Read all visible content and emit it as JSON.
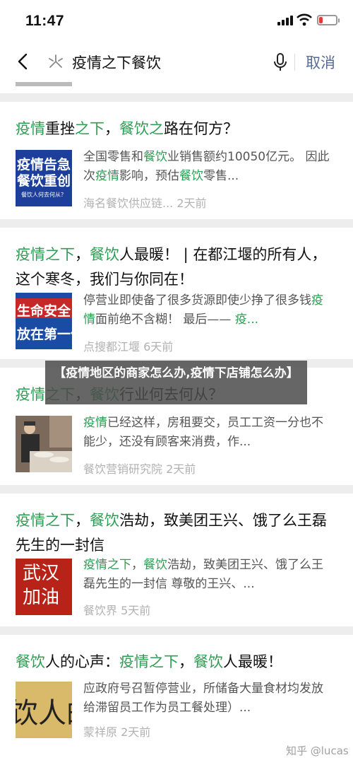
{
  "status": {
    "time": "11:47",
    "battery_level": 0.2
  },
  "search": {
    "query": "疫情之下餐饮",
    "cancel_label": "取消"
  },
  "results": [
    {
      "title": [
        [
          "疫情",
          true
        ],
        [
          "重挫",
          false
        ],
        [
          "之下",
          true
        ],
        [
          "，",
          false
        ],
        [
          "餐饮之",
          true
        ],
        [
          "路在何方？",
          false
        ]
      ],
      "snippet": [
        [
          "全国零售和",
          false
        ],
        [
          "餐饮",
          true
        ],
        [
          "业销售额约10050亿元。 因此次",
          false
        ],
        [
          "疫情",
          true
        ],
        [
          "影响，预估",
          false
        ],
        [
          "餐饮",
          true
        ],
        [
          "零售...",
          false
        ]
      ],
      "meta": "海名餐饮供应链...  2天前",
      "thumb_lines": [
        "疫情告急",
        "餐饮重创",
        "餐饮人何去何从？"
      ]
    },
    {
      "title": [
        [
          "疫情之下",
          true
        ],
        [
          "，",
          false
        ],
        [
          "餐饮",
          true
        ],
        [
          "人最暖！ | 在都江堰的所有人，这个寒冬，我们与你同在！",
          false
        ]
      ],
      "snippet": [
        [
          "停营业即使备了很多货源即使少挣了很多钱",
          false
        ],
        [
          "疫情",
          true
        ],
        [
          "面前绝不含糊！ 最后—— ",
          false
        ],
        [
          "疫...",
          true
        ]
      ],
      "meta": "点搜都江堰  6天前",
      "thumb_lines": [
        "生命安全",
        "放在第一位"
      ]
    },
    {
      "title": [
        [
          "疫情之下",
          true
        ],
        [
          "，",
          false
        ],
        [
          "餐饮",
          true
        ],
        [
          "行业何去何从？",
          false
        ]
      ],
      "snippet": [
        [
          "疫情",
          true
        ],
        [
          "已经这样，房租要交，员工工资一分也不能少，还没有顾客来消费，作...",
          false
        ]
      ],
      "meta": "餐饮营销研究院  2天前",
      "thumb_lines": []
    },
    {
      "title": [
        [
          "疫情之下",
          true
        ],
        [
          "，",
          false
        ],
        [
          "餐饮",
          true
        ],
        [
          "浩劫，致美团王兴、饿了么王磊先生的一封信",
          false
        ]
      ],
      "snippet": [
        [
          "疫情之下",
          true
        ],
        [
          "，",
          false
        ],
        [
          "餐饮",
          true
        ],
        [
          "浩劫，致美团王兴、饿了么王磊先生的一封信 尊敬的王兴、...",
          false
        ]
      ],
      "meta": "餐饮界  5天前",
      "thumb_lines": [
        "武汉",
        "加油"
      ]
    },
    {
      "title": [
        [
          "餐饮",
          true
        ],
        [
          "人的心声：",
          false
        ],
        [
          "疫情之下",
          true
        ],
        [
          "，",
          false
        ],
        [
          "餐饮",
          true
        ],
        [
          "人最暖！",
          false
        ]
      ],
      "snippet": [
        [
          "应政府号召暂停营业，所储备大量食材均发放给滞留员工作为员工餐处理）...",
          false
        ]
      ],
      "meta": "蒙祥原  2天前",
      "thumb_lines": [
        "饮人的心"
      ]
    }
  ],
  "overlay": {
    "text": "【疫情地区的商家怎么办,疫情下店铺怎么办】"
  },
  "watermark": "知乎 @lucas"
}
